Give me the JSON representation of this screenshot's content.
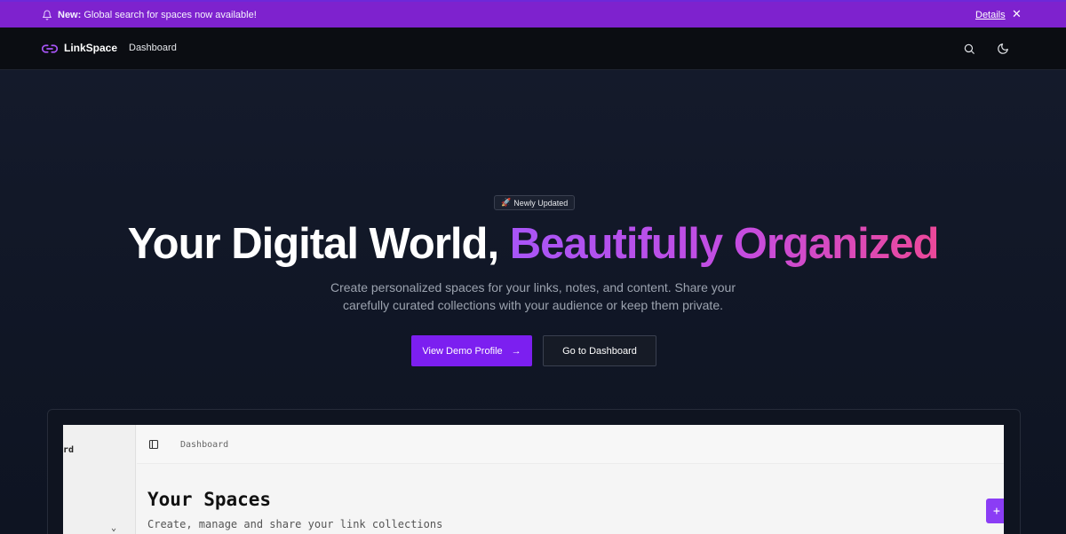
{
  "announcement": {
    "label": "New:",
    "text": "Global search for spaces now available!",
    "details_link": "Details",
    "close_symbol": "✕",
    "bell_icon": "bell-icon"
  },
  "nav": {
    "brand": "LinkSpace",
    "logo_icon": "link-icon",
    "links": [
      "Dashboard"
    ],
    "search_icon": "search-icon",
    "theme_icon": "moon-icon"
  },
  "hero": {
    "badge_emoji": "🚀",
    "badge": "Newly Updated",
    "headline_plain": "Your Digital World, ",
    "headline_highlight": "Beautifully Organized",
    "subtitle": "Create personalized spaces for your links, notes, and content. Share your carefully curated collections with your audience or keep them private.",
    "primary_button": "View Demo Profile",
    "primary_button_arrow": "→",
    "secondary_button": "Go to Dashboard"
  },
  "preview": {
    "sidebar_label": "rd",
    "sidebar_chevron": "⌄",
    "breadcrumb": "Dashboard",
    "title": "Your Spaces",
    "subtitle": "Create, manage and share your link collections",
    "add_symbol": "+"
  },
  "colors": {
    "accent": "#7c1ff0",
    "announcement_bg": "#7e22ce",
    "gradient_start": "#a855f7",
    "gradient_end": "#ec4899",
    "background": "#111827"
  }
}
